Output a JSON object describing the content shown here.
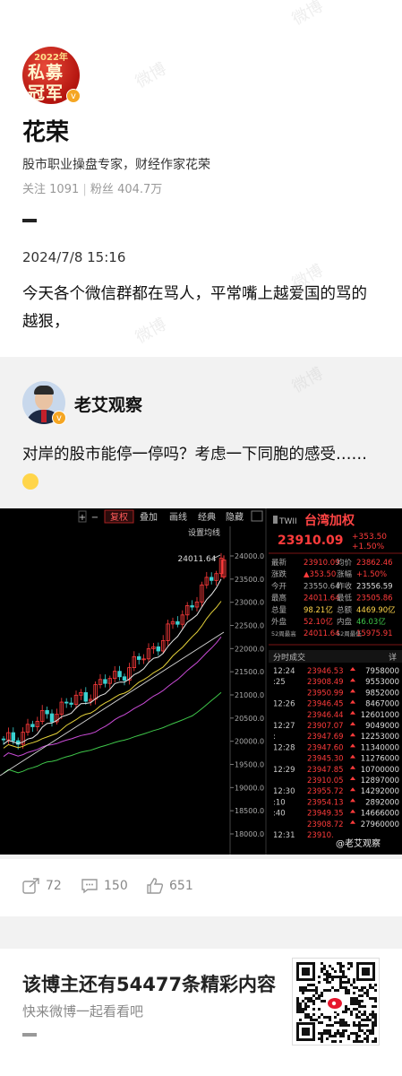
{
  "profile": {
    "avatar_year": "2022年",
    "avatar_line1": "私募",
    "avatar_line2": "冠军",
    "name": "花荣",
    "bio": "股市职业操盘专家，财经作家花荣",
    "following_label": "关注",
    "following": "1091",
    "followers_label": "粉丝",
    "followers": "404.7万"
  },
  "post": {
    "time": "2024/7/8 15:16",
    "text": "今天各个微信群都在骂人，平常嘴上越爱国的骂的越狠，"
  },
  "repost": {
    "name": "老艾观察",
    "text": "对岸的股市能停一停吗？考虑一下同胞的感受……"
  },
  "chart_panel": {
    "toolbar": [
      "+",
      "−",
      "复权",
      "叠加",
      "画线",
      "经典",
      "隐藏"
    ],
    "setting_label": "设置均线",
    "peak_label": "24011.64",
    "y_ticks": [
      "24000.0",
      "23500.0",
      "23000.0",
      "22500.0",
      "22000.0",
      "21500.0",
      "21000.0",
      "20500.0",
      "20000.0",
      "19500.0",
      "19000.0",
      "18500.0",
      "18000.0"
    ],
    "code": "TWII",
    "index_name": "台湾加权",
    "price": "23910.09",
    "change": "+353.50",
    "change_pct": "+1.50%",
    "quote_rows": [
      [
        "最新",
        "23910.09",
        "均价",
        "23862.46"
      ],
      [
        "涨跌",
        "▲353.50",
        "涨幅",
        "+1.50%"
      ],
      [
        "今开",
        "23550.64",
        "昨收",
        "23556.59"
      ],
      [
        "最高",
        "24011.64",
        "最低",
        "23505.86"
      ],
      [
        "总量",
        "98.21亿",
        "总额",
        "4469.90亿"
      ],
      [
        "外盘",
        "52.10亿",
        "内盘",
        "46.03亿"
      ],
      [
        "52周最高",
        "24011.64",
        "52周最低",
        "15975.91"
      ]
    ],
    "ticks_header": "分时成交",
    "ticks_detail": "详",
    "ticks": [
      [
        "12:24",
        "23946.53",
        "7958000"
      ],
      [
        ":25",
        "23908.49",
        "9553000"
      ],
      [
        "",
        "23950.99",
        "9852000"
      ],
      [
        "12:26",
        "23946.45",
        "8467000"
      ],
      [
        "",
        "23946.44",
        "12601000"
      ],
      [
        "12:27",
        "23907.07",
        "9049000"
      ],
      [
        ":",
        "23947.69",
        "12253000"
      ],
      [
        "12:28",
        "23947.60",
        "11340000"
      ],
      [
        "",
        "23945.30",
        "11276000"
      ],
      [
        "12:29",
        "23947.85",
        "10700000"
      ],
      [
        "",
        "23910.05",
        "12897000"
      ],
      [
        "12:30",
        "23955.72",
        "14292000"
      ],
      [
        ":10",
        "23954.13",
        "2892000"
      ],
      [
        ":40",
        "23949.35",
        "14666000"
      ],
      [
        "",
        "23908.72",
        "27960000"
      ],
      [
        "12:31",
        "23910.",
        ""
      ]
    ],
    "watermark": "@老艾观察",
    "chart_data": {
      "type": "line",
      "title": "",
      "ylabel": "",
      "ylim": [
        18000,
        24000
      ],
      "series": [
        {
          "values": [
            19950,
            20100,
            20300,
            20500,
            20650,
            20800,
            20950,
            21100,
            21300,
            21450,
            21600,
            21850,
            22100,
            22400,
            22750,
            23100,
            23400,
            23910
          ]
        }
      ]
    }
  },
  "actions": {
    "repost_count": "72",
    "comment_count": "150",
    "like_count": "651"
  },
  "promo": {
    "title": "该博主还有54477条精彩内容",
    "subtitle": "快来微博一起看看吧"
  },
  "colors": {
    "up": "#ff3b3b",
    "down": "#3ad1d1",
    "panel_bg": "#000000",
    "accent_badge": "#f5a623"
  }
}
